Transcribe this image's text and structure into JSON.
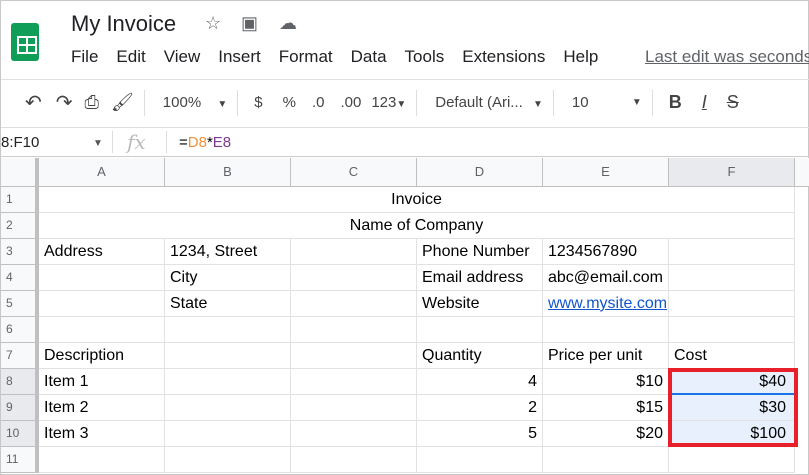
{
  "app": {
    "title": "My Invoice",
    "last_edit": "Last edit was seconds ago"
  },
  "menu": [
    "File",
    "Edit",
    "View",
    "Insert",
    "Format",
    "Data",
    "Tools",
    "Extensions",
    "Help"
  ],
  "toolbar": {
    "zoom": "100%",
    "currency": "$",
    "percent": "%",
    "dec_less": ".0",
    "dec_more": ".00",
    "format": "123",
    "font": "Default (Ari...",
    "size": "10",
    "bold": "B",
    "italic": "I",
    "strike": "S"
  },
  "formula_bar": {
    "name_box": "8:F10",
    "fx": "fx",
    "eq": "=",
    "ref1": "D8",
    "op": "*",
    "ref2": "E8",
    "ref1_color": "#f0913a",
    "ref2_color": "#7e3794"
  },
  "columns": [
    "A",
    "B",
    "C",
    "D",
    "E",
    "F"
  ],
  "rows": [
    {
      "n": "1",
      "merged": "Invoice"
    },
    {
      "n": "2",
      "merged": "Name of Company"
    },
    {
      "n": "3",
      "cells": [
        "Address",
        "1234, Street",
        "",
        "Phone Number",
        "1234567890",
        ""
      ]
    },
    {
      "n": "4",
      "cells": [
        "",
        "City",
        "",
        "Email address",
        "abc@email.com",
        ""
      ]
    },
    {
      "n": "5",
      "cells": [
        "",
        "State",
        "",
        "Website",
        "www.mysite.com",
        ""
      ]
    },
    {
      "n": "6",
      "cells": [
        "",
        "",
        "",
        "",
        "",
        ""
      ]
    },
    {
      "n": "7",
      "cells": [
        "Description",
        "",
        "",
        "Quantity",
        "Price per unit",
        "Cost"
      ]
    },
    {
      "n": "8",
      "cells": [
        "Item 1",
        "",
        "",
        "4",
        "$10",
        "$40"
      ]
    },
    {
      "n": "9",
      "cells": [
        "Item 2",
        "",
        "",
        "2",
        "$15",
        "$30"
      ]
    },
    {
      "n": "10",
      "cells": [
        "Item 3",
        "",
        "",
        "5",
        "$20",
        "$100"
      ]
    },
    {
      "n": "11",
      "cells": [
        "",
        "",
        "",
        "",
        "",
        ""
      ]
    }
  ]
}
